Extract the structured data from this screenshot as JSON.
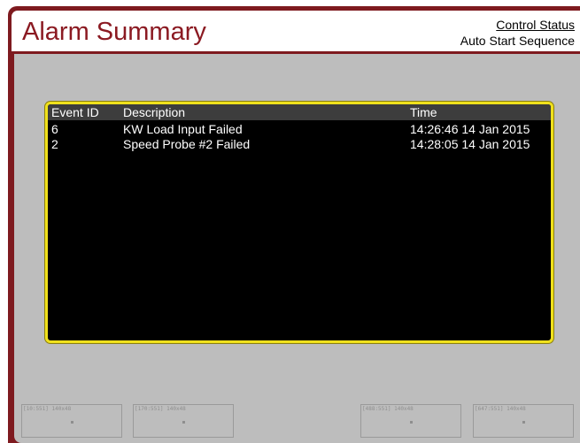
{
  "header": {
    "title": "Alarm Summary",
    "control_status_link": "Control Status",
    "sequence_label": "Auto Start Sequence"
  },
  "alarm_table": {
    "columns": [
      "Event ID",
      "Description",
      "Time"
    ],
    "rows": [
      {
        "event_id": "6",
        "description": "KW Load Input Failed",
        "time": "14:26:46 14 Jan 2015"
      },
      {
        "event_id": "2",
        "description": "Speed Probe #2 Failed",
        "time": "14:28:05 14 Jan 2015"
      }
    ]
  },
  "placeholders": [
    {
      "label": "[10:551] 140x48"
    },
    {
      "label": "[170:551] 140x48"
    },
    {
      "label": "[488:551] 140x48"
    },
    {
      "label": "[647:551] 140x48"
    }
  ],
  "colors": {
    "frame": "#7e1a1f",
    "title": "#8b1a22",
    "table_border": "#f0e11c",
    "panel": "#bdbdbd"
  }
}
